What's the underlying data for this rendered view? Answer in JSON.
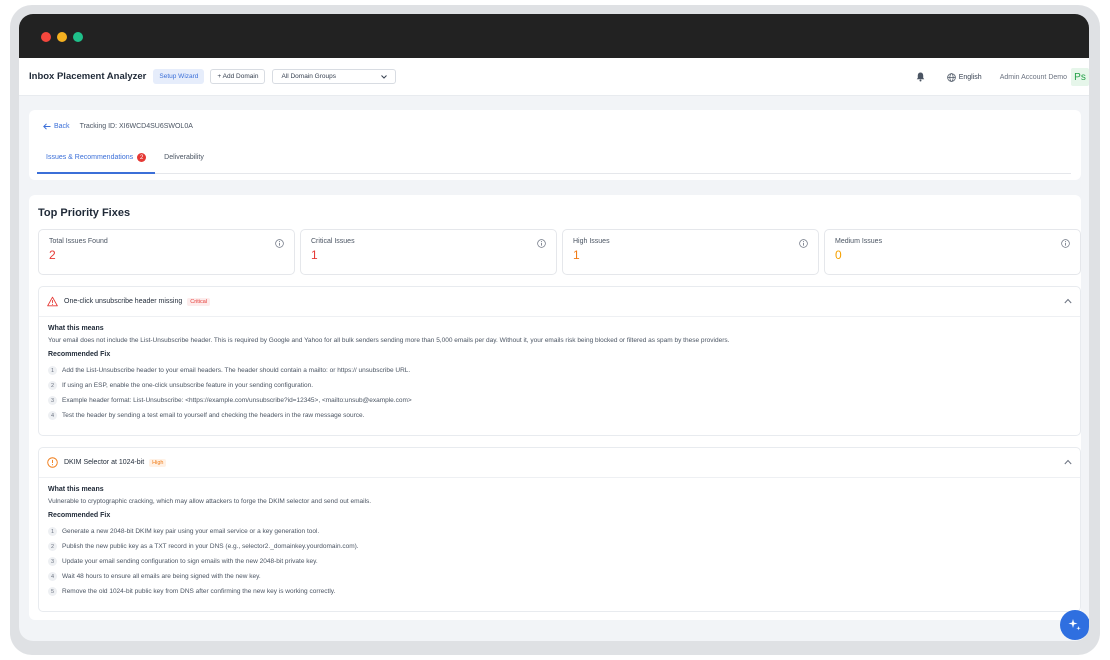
{
  "colors": {
    "accent": "#3b6fd8",
    "critical": "#e53935",
    "high": "#f07b16",
    "medium": "#f5a000"
  },
  "header": {
    "app_title": "Inbox Placement Analyzer",
    "setup_label": "Setup Wizard",
    "add_domain_label": "+ Add Domain",
    "domain_group": "All Domain Groups",
    "language": "English",
    "account": "Admin Account Demo",
    "avatar": "Ps"
  },
  "nav": {
    "back_label": "Back",
    "tracking": "Tracking ID: XI6WCD4SU6SWOL0A",
    "tabs": [
      {
        "label": "Issues & Recommendations",
        "badge": "2"
      },
      {
        "label": "Deliverability"
      }
    ]
  },
  "summary": {
    "title": "Top Priority Fixes",
    "stats": [
      {
        "label": "Total Issues Found",
        "value": "2",
        "color": "#e53935"
      },
      {
        "label": "Critical Issues",
        "value": "1",
        "color": "#e53935"
      },
      {
        "label": "High Issues",
        "value": "1",
        "color": "#f07b16"
      },
      {
        "label": "Medium Issues",
        "value": "0",
        "color": "#f5a000"
      }
    ]
  },
  "issues": [
    {
      "title": "One-click unsubscribe header missing",
      "severity": "Critical",
      "what_title": "What this means",
      "description": "Your email does not include the List-Unsubscribe header. This is required by Google and Yahoo for all bulk senders sending more than 5,000 emails per day. Without it, your emails risk being blocked or filtered as spam by these providers.",
      "fix_title": "Recommended Fix",
      "steps": [
        {
          "n": "1",
          "text": "Add the List-Unsubscribe header to your email headers. The header should contain a mailto: or https:// unsubscribe URL."
        },
        {
          "n": "2",
          "text": "If using an ESP, enable the one-click unsubscribe feature in your sending configuration."
        },
        {
          "n": "3",
          "text": "Example header format: List-Unsubscribe: <https://example.com/unsubscribe?id=12345>, <mailto:unsub@example.com>"
        },
        {
          "n": "4",
          "text": "Test the header by sending a test email to yourself and checking the headers in the raw message source."
        }
      ]
    },
    {
      "title": "DKIM Selector at 1024-bit",
      "severity": "High",
      "what_title": "What this means",
      "description": "Vulnerable to cryptographic cracking, which may allow attackers to forge the DKIM selector and send out emails.",
      "fix_title": "Recommended Fix",
      "steps": [
        {
          "n": "1",
          "text": "Generate a new 2048-bit DKIM key pair using your email service or a key generation tool."
        },
        {
          "n": "2",
          "text": "Publish the new public key as a TXT record in your DNS (e.g., selector2._domainkey.yourdomain.com)."
        },
        {
          "n": "3",
          "text": "Update your email sending configuration to sign emails with the new 2048-bit private key."
        },
        {
          "n": "4",
          "text": "Wait 48 hours to ensure all emails are being signed with the new key."
        },
        {
          "n": "5",
          "text": "Remove the old 1024-bit public key from DNS after confirming the new key is working correctly."
        }
      ]
    }
  ]
}
